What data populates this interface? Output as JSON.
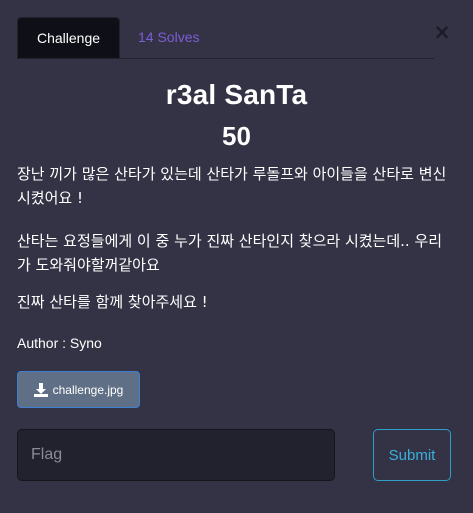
{
  "modal": {
    "close_glyph": "×",
    "tabs": {
      "challenge_label": "Challenge",
      "solves_label": "14 Solves"
    },
    "challenge": {
      "name": "r3al SanTa",
      "value": "50",
      "description": [
        "장난 끼가 많은 산타가 있는데 산타가 루돌프와 아이들을 산타로 변신 시켰어요 !",
        "산타는 요정들에게 이 중 누가 진짜 산타인지 찾으라 시켰는데.. 우리가 도와줘야할꺼같아요",
        "진짜 산타를 함께 찾아주세요 !"
      ],
      "author": "Author : Syno",
      "file": {
        "label": "challenge.jpg",
        "icon": "download-icon"
      }
    },
    "submission": {
      "flag_placeholder": "Flag",
      "flag_value": "",
      "submit_label": "Submit"
    }
  },
  "colors": {
    "background": "#333345",
    "tab_active_bg": "#0f0f18",
    "solves_link": "#7e5dd6",
    "file_button_bg": "#5f6f86",
    "file_button_border": "#3d7fd0",
    "input_bg": "#22222f",
    "submit_accent": "#3ab0dc"
  }
}
